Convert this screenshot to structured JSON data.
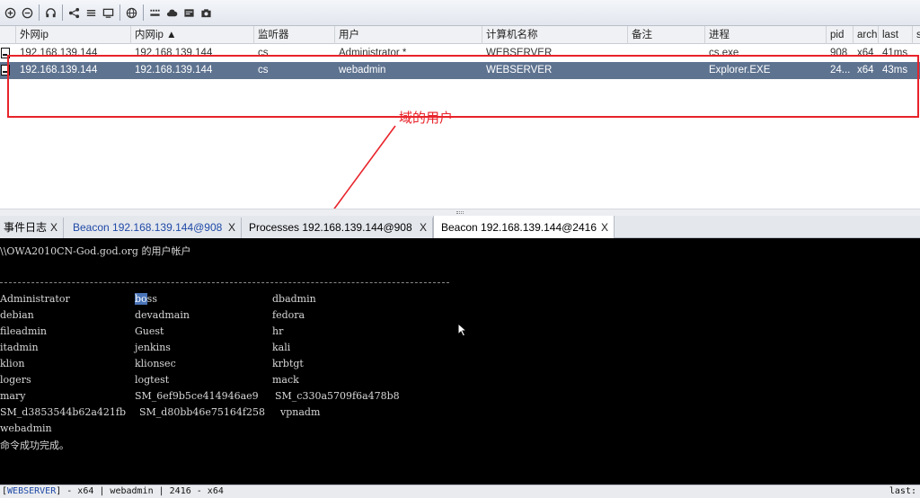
{
  "beacon_table": {
    "columns": [
      "外网ip",
      "内网ip ▲",
      "监听器",
      "用户",
      "计算机名称",
      "备注",
      "进程",
      "pid",
      "arch",
      "last",
      "s"
    ],
    "rows": [
      [
        "192.168.139.144",
        "192.168.139.144",
        "cs",
        "Administrator *",
        "WEBSERVER",
        "",
        "cs.exe",
        "908",
        "x64",
        "41ms"
      ],
      [
        "192.168.139.144",
        "192.168.139.144",
        "cs",
        "webadmin",
        "WEBSERVER",
        "",
        "Explorer.EXE",
        "24...",
        "x64",
        "43ms"
      ]
    ]
  },
  "annotation": {
    "label": "域的用户",
    "color": "#e8232a"
  },
  "tabs": [
    {
      "label": "事件日志",
      "close": "X"
    },
    {
      "label": "Beacon 192.168.139.144@908",
      "close": "X"
    },
    {
      "label": "Processes 192.168.139.144@908",
      "close": "X"
    },
    {
      "label": "Beacon 192.168.139.144@2416",
      "close": "X"
    }
  ],
  "console": {
    "header": "\\\\OWA2010CN-God.god.org 的用户帐户",
    "users": [
      [
        "Administrator",
        "boss",
        "dbadmin"
      ],
      [
        "debian",
        "devadmain",
        "fedora"
      ],
      [
        "fileadmin",
        "Guest",
        "hr"
      ],
      [
        "itadmin",
        "jenkins",
        "kali"
      ],
      [
        "klion",
        "klionsec",
        "krbtgt"
      ],
      [
        "logers",
        "logtest",
        "mack"
      ],
      [
        "mary",
        "SM_6ef9b5ce414946ae9",
        "SM_c330a5709f6a478b8"
      ],
      [
        "SM_d3853544b62a421fb",
        "SM_d80bb46e75164f258",
        "vpnadm"
      ],
      [
        "webadmin",
        "",
        ""
      ]
    ],
    "done_message": "命令成功完成。"
  },
  "status": {
    "bracket_open": "[",
    "host": "WEBSERVER",
    "rest": "] - x64 | webadmin | 2416 - x64",
    "right": "last:"
  },
  "colors": {
    "selected_row": "#5e7390",
    "highlight": "#e8232a",
    "console_bg": "#000000"
  }
}
